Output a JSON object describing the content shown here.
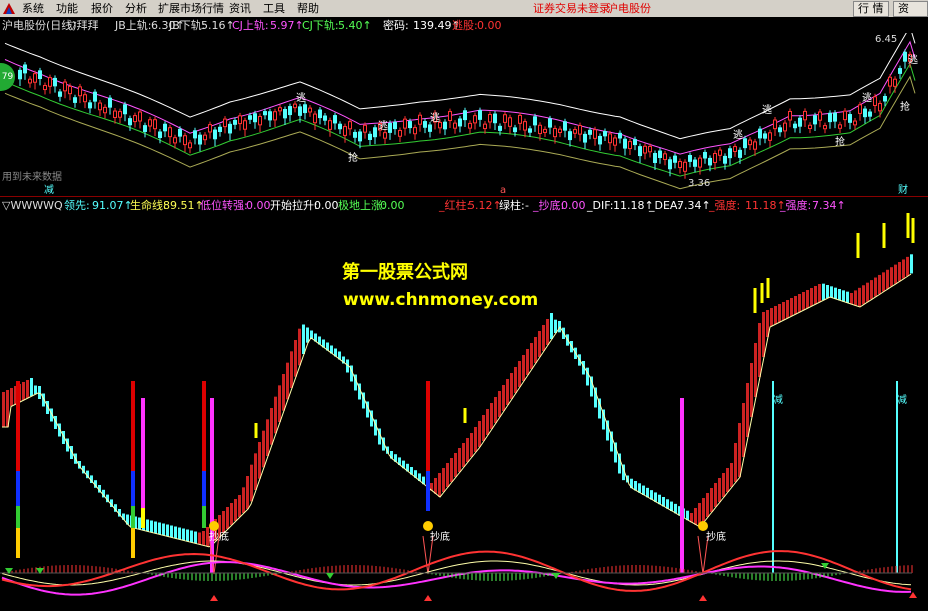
{
  "menubar": {
    "items": [
      "系统",
      "功能",
      "报价",
      "分析",
      "扩展市场行情",
      "资讯",
      "工具",
      "帮助"
    ],
    "status_text": "证券交易未登录",
    "stock_name": "沪电股份",
    "buttons": [
      "行 情",
      "资 讯"
    ],
    "win_controls": [
      "—",
      "□",
      "◇",
      "×"
    ]
  },
  "kline_header": {
    "title": "沪电股份(日线)",
    "indicator": "▽拜拜",
    "fields": [
      {
        "label": "JB上轨:",
        "value": "6.30↑",
        "color": "#dddddd"
      },
      {
        "label": "JB下轨:",
        "value": "5.16↑",
        "color": "#dddddd"
      },
      {
        "label": "CJ上轨:",
        "value": "5.97↑",
        "color": "#ff55ff"
      },
      {
        "label": "CJ下轨:",
        "value": "5.40↑",
        "color": "#55ff55"
      },
      {
        "label": "密码:",
        "value": "139.49↑",
        "color": "#ffffff"
      },
      {
        "label": "逃股:",
        "value": "0.00",
        "color": "#ff3333"
      }
    ]
  },
  "kline_labels": {
    "high": "6.45",
    "low": "3.36",
    "badge": "79",
    "future": "用到未来数据",
    "escape": "逃",
    "grab": "抢",
    "bottom_left": "减",
    "bottom_mid": "a",
    "bottom_right": "财"
  },
  "indicator_header": {
    "title": "▽WWWWQ",
    "fields": [
      {
        "label": "领先:",
        "value": "91.07↑",
        "color": "#55ffff"
      },
      {
        "label": "生命线:",
        "value": "89.51↑",
        "color": "#ffff55"
      },
      {
        "label": "低位转强:",
        "value": "0.00",
        "color": "#ff55ff"
      },
      {
        "label": "开始拉升:",
        "value": "0.00",
        "color": "#ffffff"
      },
      {
        "label": "极地上涨:",
        "value": "0.00",
        "color": "#55ff55"
      },
      {
        "label": "_红柱:",
        "value": "5.12↑",
        "color": "#ff3333"
      },
      {
        "label": "绿柱:",
        "value": "-",
        "color": "#ffffff"
      },
      {
        "label": "_抄底:",
        "value": "0.00",
        "color": "#ff55ff"
      },
      {
        "label": "_DIF:",
        "value": "11.18↑",
        "color": "#ffffff"
      },
      {
        "label": "_DEA:",
        "value": "7.34↑",
        "color": "#ffffff"
      },
      {
        "label": "_强度:",
        "value": "11.18↑",
        "color": "#ff3333"
      },
      {
        "label": "_强度:",
        "value": "7.34↑",
        "color": "#ff55ff"
      }
    ]
  },
  "watermark": {
    "line1": "第一股票公式网",
    "line2": "www.chnmoney.com"
  },
  "indicator_labels": {
    "chaodi": "抄底",
    "jian": "减"
  },
  "colors": {
    "up": "#ff3333",
    "down": "#55ffff",
    "yellow": "#ffff00",
    "mauve": "#ff55ff",
    "green": "#33cc33"
  }
}
